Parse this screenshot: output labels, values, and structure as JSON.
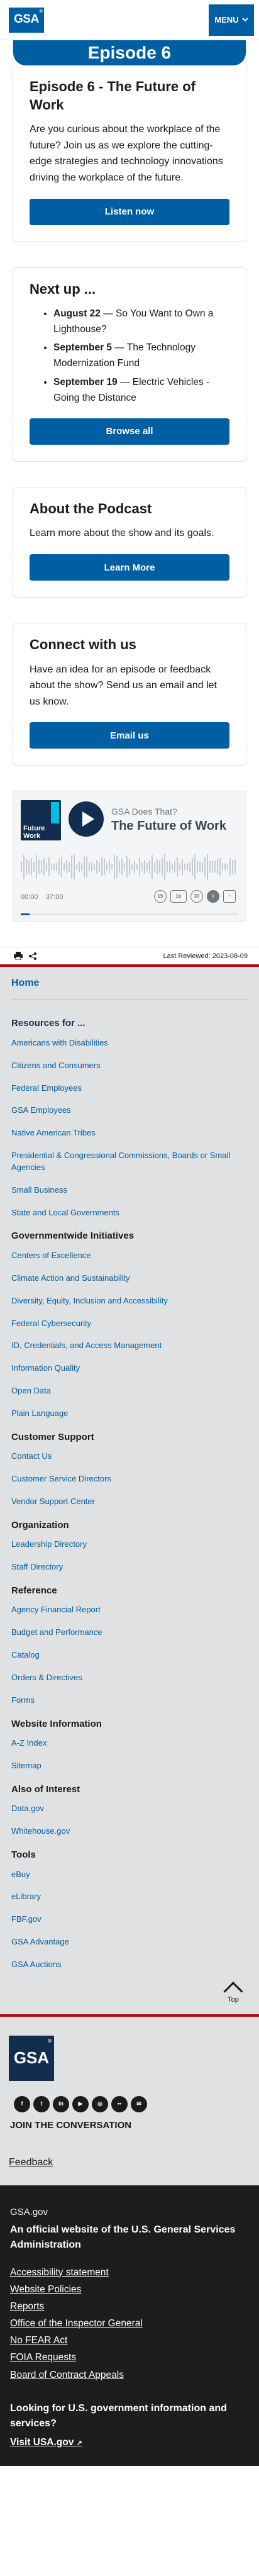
{
  "header": {
    "logo_text": "GSA",
    "logo_mark": "®",
    "menu_label": "MENU",
    "menu_icon": "chevron-down-icon"
  },
  "episode_card": {
    "banner": "Episode 6",
    "title": "Episode 6 - The Future of Work",
    "description": "Are you curious about the workplace of the future? Join us as we explore the cutting-edge strategies and technology innovations driving the workplace of the future.",
    "button_label": "Listen now"
  },
  "next_up": {
    "title": "Next up ...",
    "items": [
      {
        "date": "August 22",
        "text": " — So You Want to Own a Lighthouse?"
      },
      {
        "date": "September 5",
        "text": " — The Technology Modernization Fund"
      },
      {
        "date": "September 19",
        "text": " — Electric Vehicles - Going the Distance"
      }
    ],
    "button_label": "Browse all"
  },
  "about": {
    "title": "About the Podcast",
    "description": "Learn more about the show and its goals.",
    "button_label": "Learn More"
  },
  "connect": {
    "title": "Connect with us",
    "description": "Have an idea for an episode or feedback about the show? Send us an email and let us know.",
    "button_label": "Email us"
  },
  "player": {
    "art_text_1": "Future",
    "art_text_2": "Work",
    "podcast_name": "GSA Does That?",
    "episode_name": "The Future of Work",
    "time_current": "00:00",
    "time_total": "37:00",
    "progress": 0.04,
    "controls": [
      "15",
      "1x",
      "30",
      "i",
      "share"
    ]
  },
  "share_bar": {
    "last_reviewed": "Last Reviewed: 2023-08-09",
    "icons": [
      "print-icon",
      "share-icon"
    ]
  },
  "footer_nav": {
    "home": "Home",
    "sections": [
      {
        "heading": "Resources for ...",
        "links": [
          "Americans with Disabilities",
          "Citizens and Consumers",
          "Federal Employees",
          "GSA Employees",
          "Native American Tribes",
          "Presidential & Congressional Commissions, Boards or Small Agencies",
          "Small Business",
          "State and Local Governments"
        ]
      },
      {
        "heading": "Governmentwide Initiatives",
        "links": [
          "Centers of Excellence",
          "Climate Action and Sustainability",
          "Diversity, Equity, Inclusion and Accessibility",
          "Federal Cybersecurity",
          "ID, Credentials, and Access Management",
          "Information Quality",
          "Open Data",
          "Plain Language"
        ]
      },
      {
        "heading": "Customer Support",
        "links": [
          "Contact Us",
          "Customer Service Directors",
          "Vendor Support Center"
        ]
      },
      {
        "heading": "Organization",
        "links": [
          "Leadership Directory",
          "Staff Directory"
        ]
      },
      {
        "heading": "Reference",
        "links": [
          "Agency Financial Report",
          "Budget and Performance",
          "Catalog",
          "Orders & Directives",
          "Forms"
        ]
      },
      {
        "heading": "Website Information",
        "links": [
          "A-Z Index",
          "Sitemap"
        ]
      },
      {
        "heading": "Also of Interest",
        "links": [
          "Data.gov",
          "Whitehouse.gov"
        ]
      },
      {
        "heading": "Tools",
        "links": [
          "eBuy",
          "eLibrary",
          "FBF.gov",
          "GSA Advantage",
          "GSA Auctions"
        ]
      }
    ],
    "top_label": "Top"
  },
  "footer": {
    "logo_text": "GSA",
    "logo_mark": "®",
    "socials": [
      "facebook-icon",
      "twitter-icon",
      "linkedin-icon",
      "youtube-icon",
      "instagram-icon",
      "flickr-icon",
      "email-icon"
    ],
    "join": "JOIN THE CONVERSATION",
    "feedback": "Feedback",
    "domain": "GSA.gov",
    "official": "An official website of the U.S. General Services Administration",
    "links": [
      "Accessibility statement",
      "Website Policies",
      "Reports",
      "Office of the Inspector General",
      "No FEAR Act",
      "FOIA Requests",
      "Board of Contract Appeals"
    ],
    "question": "Looking for U.S. government information and services?",
    "visit": "Visit USA.gov"
  }
}
